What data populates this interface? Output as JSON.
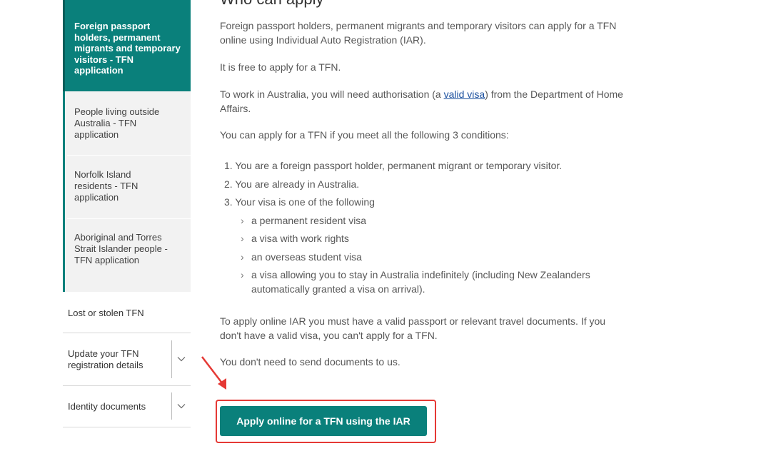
{
  "sidebar": {
    "active_item": "Foreign passport holders, permanent migrants and temporary visitors - TFN application",
    "sub_items": [
      "People living outside Australia - TFN application",
      "Norfolk Island residents - TFN application",
      "Aboriginal and Torres Strait Islander people - TFN application"
    ],
    "nav_items": [
      {
        "label": "Lost or stolen TFN",
        "expandable": false
      },
      {
        "label": "Update your TFN registration details",
        "expandable": true
      },
      {
        "label": "Identity documents",
        "expandable": true
      }
    ]
  },
  "main": {
    "heading": "Who can apply",
    "intro": "Foreign passport holders, permanent migrants and temporary visitors can apply for a TFN online using Individual Auto Registration (IAR).",
    "free_text": "It is free to apply for a TFN.",
    "work_text_before": "To work in Australia, you will need authorisation (a ",
    "work_link": "valid visa",
    "work_text_after": ") from the Department of Home Affairs.",
    "conditions_intro": "You can apply for a TFN if you meet all the following 3  conditions:",
    "conditions": [
      "1. You are a foreign passport holder, permanent migrant or temporary visitor.",
      "2. You are already in Australia.",
      "3. Your visa is one of the following"
    ],
    "visa_types": [
      "a permanent resident visa",
      "a visa with work rights",
      "an overseas student visa",
      "a visa allowing you to stay in Australia indefinitely (including New Zealanders automatically granted a visa on arrival)."
    ],
    "passport_text": "To apply online IAR you must have a valid passport or relevant travel documents. If you don't have a valid visa, you can't apply for a TFN.",
    "no_docs_text": "You don't need to send documents to us.",
    "cta_label": "Apply online for a TFN using the IAR"
  },
  "colors": {
    "accent": "#0a807b",
    "highlight": "#e53935",
    "link": "#1a4f9e"
  }
}
